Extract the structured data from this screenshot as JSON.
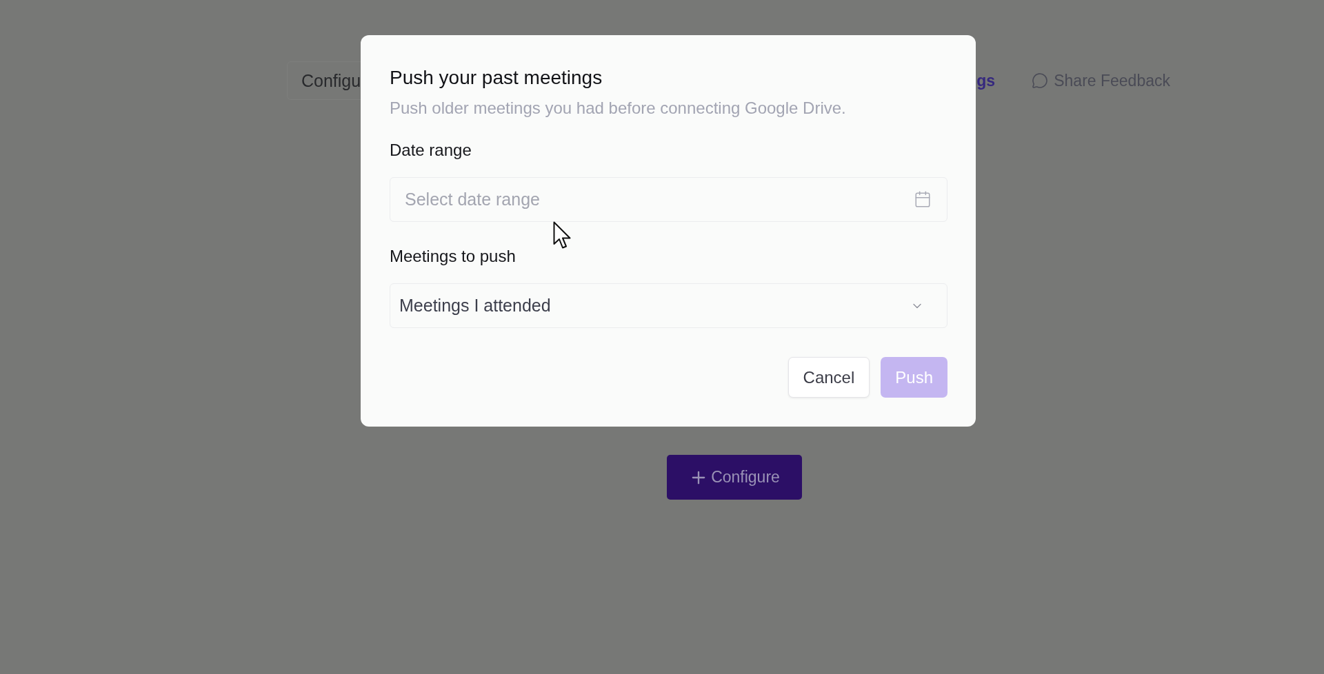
{
  "header": {
    "tabs": [
      {
        "label": "Configu",
        "selected": false
      },
      {
        "label": "gs",
        "selected": true
      }
    ],
    "feedback": {
      "label": "Share Feedback"
    }
  },
  "configure_button": {
    "label": "Configure"
  },
  "modal": {
    "title": "Push your past meetings",
    "description": "Push older meetings you had before connecting Google Drive.",
    "fields": [
      {
        "kind": "date",
        "label": "Date range",
        "placeholder": "Select date range"
      },
      {
        "kind": "select",
        "label": "Meetings to push",
        "value": "Meetings I attended"
      }
    ],
    "buttons": [
      {
        "label": "Cancel",
        "kind": "secondary",
        "disabled": false
      },
      {
        "label": "Push",
        "kind": "primary",
        "disabled": true
      }
    ]
  }
}
